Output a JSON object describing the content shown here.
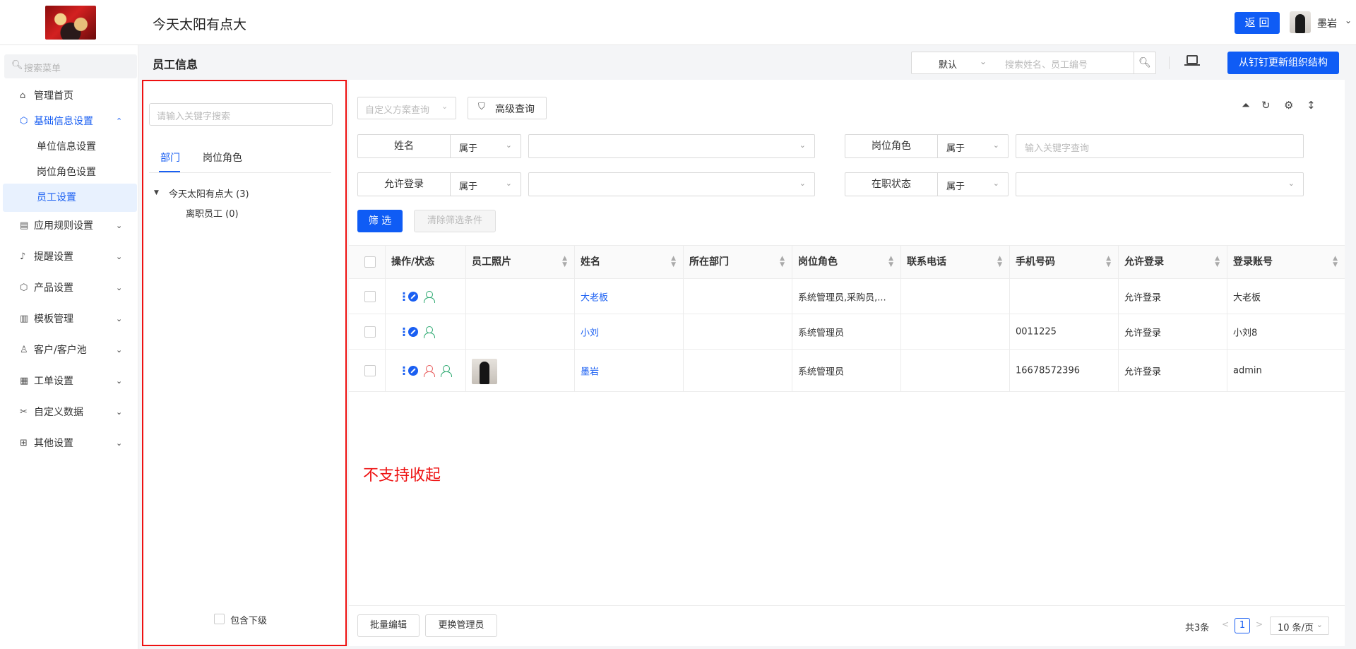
{
  "header": {
    "app_title": "今天太阳有点大",
    "back_label": "返 回",
    "user_name": "墨岩"
  },
  "sidebar": {
    "search_placeholder": "搜索菜单",
    "items": [
      {
        "label": "管理首页",
        "icon": "home-icon"
      },
      {
        "label": "基础信息设置",
        "icon": "cube-icon"
      },
      {
        "label": "应用规则设置",
        "icon": "doc-icon"
      },
      {
        "label": "提醒设置",
        "icon": "bell-icon"
      },
      {
        "label": "产品设置",
        "icon": "cube-icon"
      },
      {
        "label": "模板管理",
        "icon": "template-icon"
      },
      {
        "label": "客户/客户池",
        "icon": "customer-icon"
      },
      {
        "label": "工单设置",
        "icon": "order-icon"
      },
      {
        "label": "自定义数据",
        "icon": "custom-icon"
      },
      {
        "label": "其他设置",
        "icon": "grid-icon"
      }
    ],
    "sub_items": [
      {
        "label": "单位信息设置"
      },
      {
        "label": "岗位角色设置"
      },
      {
        "label": "员工设置"
      }
    ]
  },
  "main": {
    "page_title": "员工信息",
    "view_select": "默认",
    "search_placeholder": "搜索姓名、员工编号",
    "sync_label": "从钉钉更新组织结构"
  },
  "tree": {
    "search_placeholder": "请输入关键字搜索",
    "tabs": [
      "部门",
      "岗位角色"
    ],
    "root": "今天太阳有点大 (3)",
    "child": "离职员工 (0)",
    "include_label": "包含下级"
  },
  "filters": {
    "scheme_placeholder": "自定义方案查询",
    "advanced_label": "高级查询",
    "rows": [
      {
        "label": "姓名",
        "op": "属于",
        "value": ""
      },
      {
        "label": "岗位角色",
        "op": "属于",
        "value": "输入关键字查询"
      },
      {
        "label": "允许登录",
        "op": "属于",
        "value": ""
      },
      {
        "label": "在职状态",
        "op": "属于",
        "value": ""
      }
    ],
    "filter_label": "筛 选",
    "clear_label": "清除筛选条件"
  },
  "table": {
    "columns": [
      "操作/状态",
      "员工照片",
      "姓名",
      "所在部门",
      "岗位角色",
      "联系电话",
      "手机号码",
      "允许登录",
      "登录账号"
    ],
    "rows": [
      {
        "name": "大老板",
        "dept": "",
        "role": "系统管理员,采购员,...",
        "phone": "",
        "mobile": "",
        "login": "允许登录",
        "account": "大老板"
      },
      {
        "name": "小刘",
        "dept": "",
        "role": "系统管理员",
        "phone": "",
        "mobile": "0011225",
        "login": "允许登录",
        "account": "小刘8"
      },
      {
        "name": "墨岩",
        "dept": "",
        "role": "系统管理员",
        "phone": "",
        "mobile": "16678572396",
        "login": "允许登录",
        "account": "admin"
      }
    ]
  },
  "annotation": "不支持收起",
  "footer": {
    "batch_label": "批量编辑",
    "replace_label": "更换管理员",
    "total": "共3条",
    "page": "1",
    "page_size": "10 条/页"
  },
  "colors": {
    "primary": "#0f5cf5",
    "annotation": "#ee1111"
  }
}
